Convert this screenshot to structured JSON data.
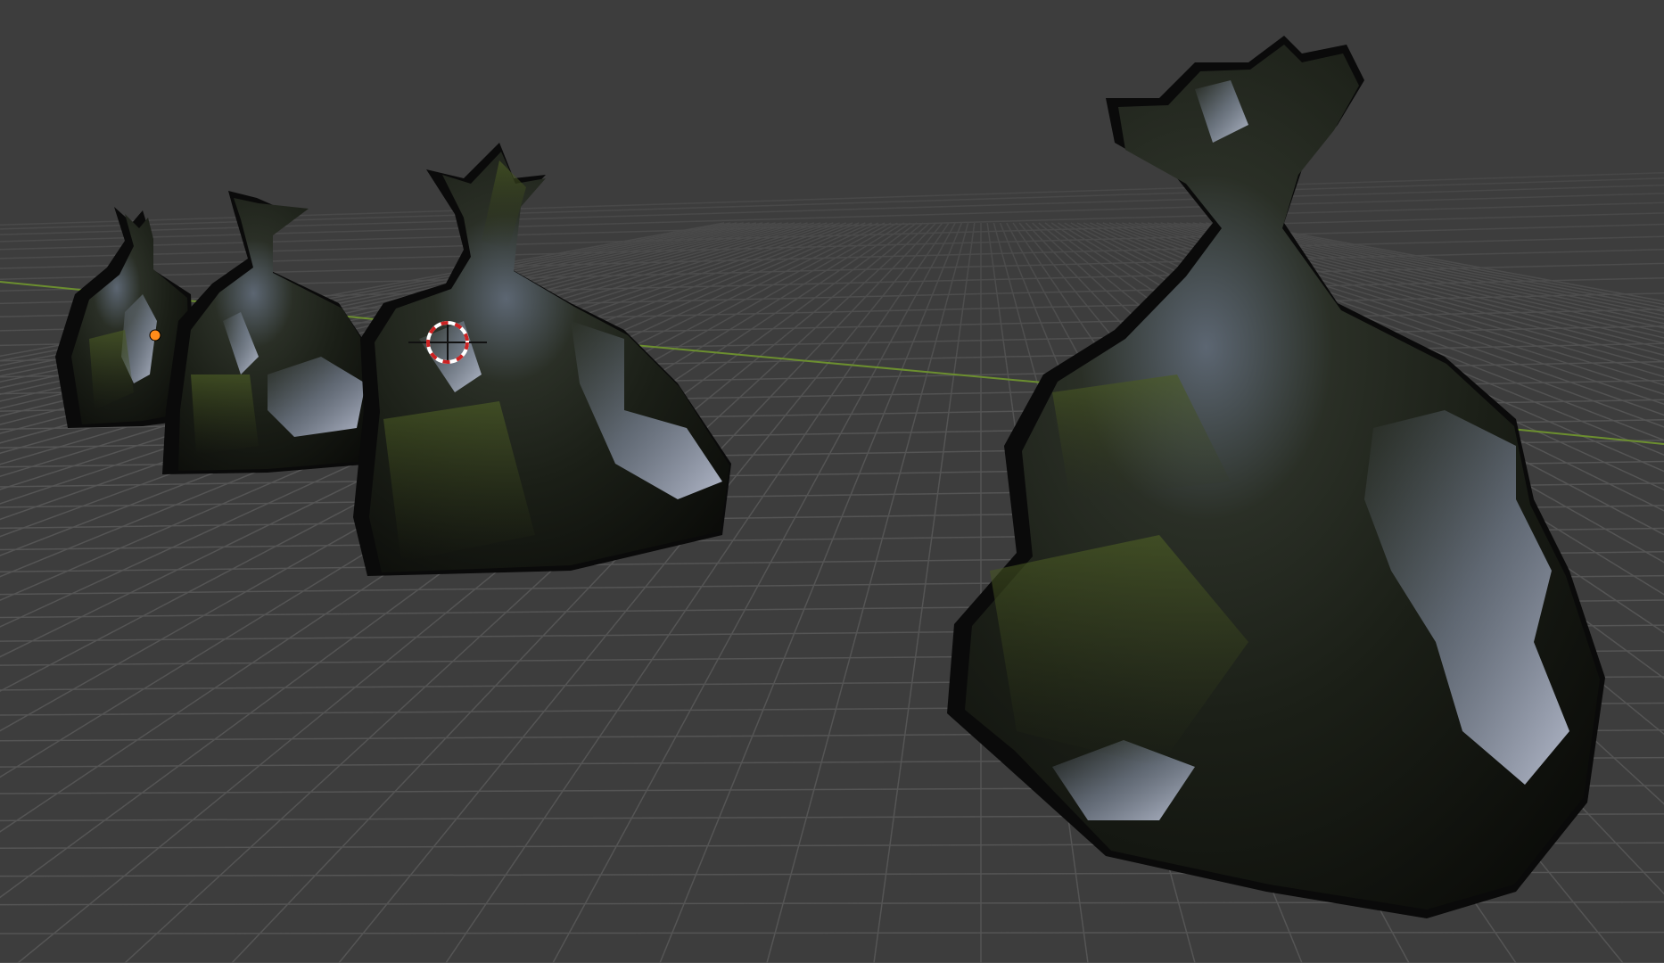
{
  "viewport": {
    "background_color": "#3d3d3d",
    "grid_color": "#555555",
    "grid_visible": true,
    "axis_x_color": "#6c8f2f",
    "selection_origin_color": "#ff8c1a",
    "cursor_colors": [
      "#cc2222",
      "#ffffff"
    ]
  },
  "objects": [
    {
      "name": "trash-bag-1",
      "type": "mesh",
      "material": "glossy-black"
    },
    {
      "name": "trash-bag-2",
      "type": "mesh",
      "material": "glossy-black"
    },
    {
      "name": "trash-bag-3",
      "type": "mesh",
      "material": "glossy-black"
    },
    {
      "name": "trash-bag-4",
      "type": "mesh",
      "material": "glossy-black"
    }
  ]
}
